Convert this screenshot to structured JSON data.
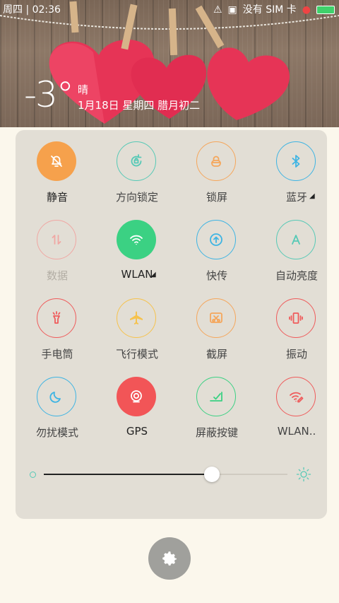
{
  "status_bar": {
    "left_text": "周四 | 02:36",
    "carrier": "没有 SIM 卡"
  },
  "header": {
    "temperature": "-3°",
    "weather": "晴",
    "date": "1月18日 星期四 腊月初二"
  },
  "quick_settings": {
    "tiles": [
      {
        "label": "静音",
        "icon": "bell-off-icon",
        "state": "on",
        "color": "#f6a14c"
      },
      {
        "label": "方向锁定",
        "icon": "rotation-lock-icon",
        "state": "off",
        "color": "#56c9b6"
      },
      {
        "label": "锁屏",
        "icon": "lock-icon",
        "state": "off",
        "color": "#f5a65b"
      },
      {
        "label": "蓝牙",
        "icon": "bluetooth-icon",
        "state": "off",
        "color": "#3eb4e3"
      },
      {
        "label": "数据",
        "icon": "data-arrows-icon",
        "state": "disabled",
        "color": "#f0a7a3"
      },
      {
        "label": "WLAN",
        "icon": "wifi-icon",
        "state": "on",
        "color": "#3bd183"
      },
      {
        "label": "快传",
        "icon": "upload-icon",
        "state": "off",
        "color": "#3eb4e3"
      },
      {
        "label": "自动亮度",
        "icon": "auto-brightness-icon",
        "state": "off",
        "color": "#56c9b6"
      },
      {
        "label": "手电筒",
        "icon": "flashlight-icon",
        "state": "off",
        "color": "#ef5b5b"
      },
      {
        "label": "飞行模式",
        "icon": "airplane-icon",
        "state": "off",
        "color": "#f6c24c"
      },
      {
        "label": "截屏",
        "icon": "screenshot-icon",
        "state": "off",
        "color": "#f5a65b"
      },
      {
        "label": "振动",
        "icon": "vibrate-icon",
        "state": "off",
        "color": "#ef5b5b"
      },
      {
        "label": "勿扰模式",
        "icon": "moon-icon",
        "state": "off",
        "color": "#3eb4e3"
      },
      {
        "label": "GPS",
        "icon": "gps-icon",
        "state": "on",
        "color": "#f25557"
      },
      {
        "label": "屏蔽按键",
        "icon": "block-keys-icon",
        "state": "off",
        "color": "#3bd183"
      },
      {
        "label": "WLAN..",
        "icon": "wifi-hotspot-icon",
        "state": "off",
        "color": "#ef5b5b"
      }
    ]
  },
  "brightness": {
    "level": 0.69
  },
  "colors": {
    "panel": "#e2ded5",
    "background": "#fbf7ec",
    "settings_button": "#a0a09c"
  }
}
